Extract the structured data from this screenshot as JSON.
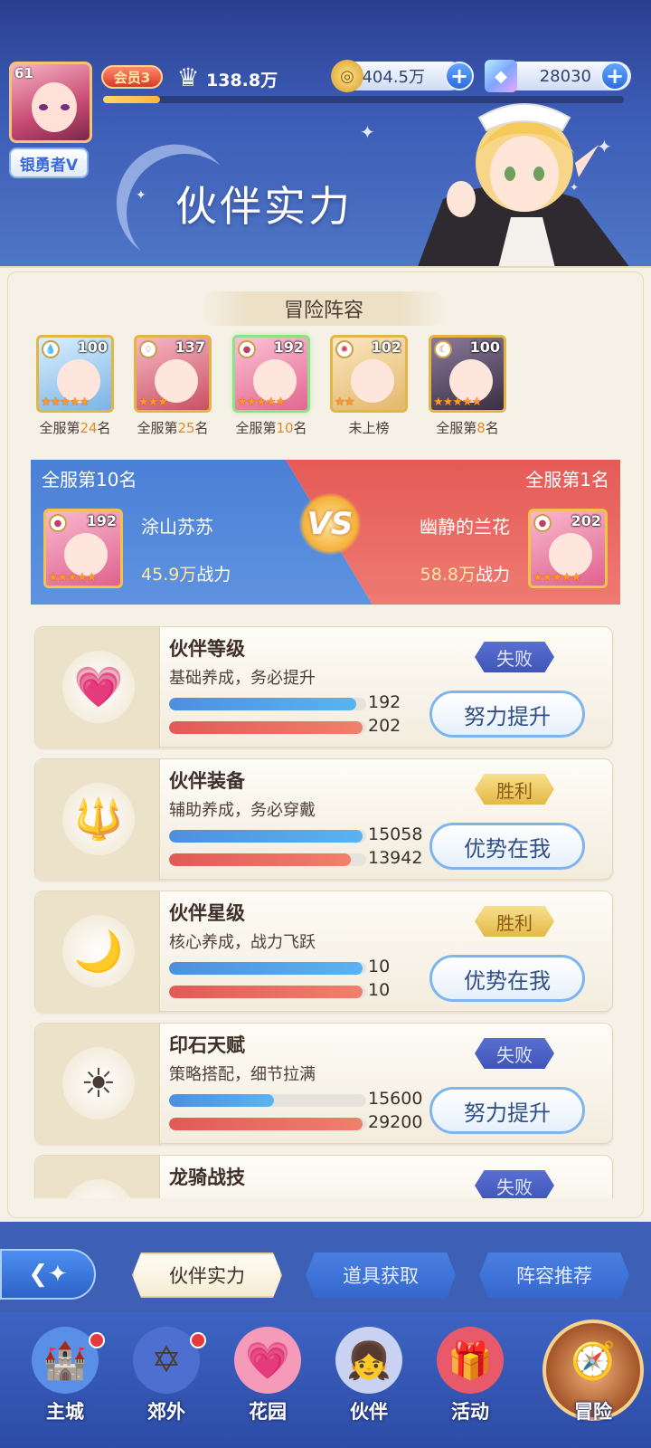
{
  "header": {
    "player_level": "61",
    "rank_title": "银勇者V",
    "vip_label": "会员3",
    "power": "138.8万",
    "exp_progress": 0.11,
    "gold": "404.5万",
    "diamonds": "28030",
    "title": "伙伴实力"
  },
  "section_title": "冒险阵容",
  "heroes": [
    {
      "level": "100",
      "rank_prefix": "全服第",
      "rank_num": "24",
      "rank_suffix": "名",
      "element": "water",
      "stars": 5,
      "colors": [
        "#d8f0ff",
        "#7cb3e6"
      ]
    },
    {
      "level": "137",
      "rank_prefix": "全服第",
      "rank_num": "25",
      "rank_suffix": "名",
      "element": "wind",
      "stars": 3,
      "colors": [
        "#f7b7c4",
        "#c95063"
      ]
    },
    {
      "level": "192",
      "rank_prefix": "全服第",
      "rank_num": "10",
      "rank_suffix": "名",
      "element": "fire",
      "stars": 5,
      "colors": [
        "#fbc2d4",
        "#e2668f"
      ]
    },
    {
      "level": "102",
      "rank_prefix": "",
      "rank_num": "",
      "rank_suffix": "未上榜",
      "element": "light",
      "stars": 2,
      "colors": [
        "#fbe7c0",
        "#e2b86c"
      ]
    },
    {
      "level": "100",
      "rank_prefix": "全服第",
      "rank_num": "8",
      "rank_suffix": "名",
      "element": "dark",
      "stars": 5,
      "colors": [
        "#8a7a9a",
        "#3a2f44"
      ]
    }
  ],
  "vs": {
    "left_rank": "全服第10名",
    "right_rank": "全服第1名",
    "left_level": "192",
    "right_level": "202",
    "left_name": "涂山苏苏",
    "right_name": "幽静的兰花",
    "left_power_value": "45.9万",
    "right_power_value": "58.8万",
    "power_unit": "战力",
    "logo": "VS"
  },
  "compare": [
    {
      "title": "伙伴等级",
      "desc": "基础养成，务必提升",
      "my": "192",
      "their": "202",
      "my_ratio": 0.95,
      "their_ratio": 0.98,
      "result": "失败",
      "result_type": "lose",
      "action": "努力提升",
      "icon": "exp-heart-icon",
      "glyph": "💗"
    },
    {
      "title": "伙伴装备",
      "desc": "辅助养成，务必穿戴",
      "my": "15058",
      "their": "13942",
      "my_ratio": 0.98,
      "their_ratio": 0.92,
      "result": "胜利",
      "result_type": "win",
      "action": "优势在我",
      "icon": "trident-icon",
      "glyph": "🔱"
    },
    {
      "title": "伙伴星级",
      "desc": "核心养成，战力飞跃",
      "my": "10",
      "their": "10",
      "my_ratio": 0.98,
      "their_ratio": 0.98,
      "result": "胜利",
      "result_type": "win",
      "action": "优势在我",
      "icon": "moon-star-icon",
      "glyph": "🌙"
    },
    {
      "title": "印石天赋",
      "desc": "策略搭配，细节拉满",
      "my": "15600",
      "their": "29200",
      "my_ratio": 0.53,
      "their_ratio": 0.98,
      "result": "失败",
      "result_type": "lose",
      "action": "努力提升",
      "icon": "sun-seal-icon",
      "glyph": "☀"
    },
    {
      "title": "龙骑战技",
      "desc": "",
      "my": "",
      "their": "",
      "my_ratio": 0,
      "their_ratio": 0,
      "result": "失败",
      "result_type": "lose",
      "action": "",
      "icon": "dragon-skill-icon",
      "glyph": "✦"
    }
  ],
  "tabs": [
    {
      "label": "伙伴实力",
      "active": true
    },
    {
      "label": "道具获取",
      "active": false
    },
    {
      "label": "阵容推荐",
      "active": false
    }
  ],
  "nav": [
    {
      "label": "主城",
      "icon": "castle-icon",
      "glyph": "🏰",
      "dot": true
    },
    {
      "label": "郊外",
      "icon": "portal-icon",
      "glyph": "✡",
      "dot": true
    },
    {
      "label": "花园",
      "icon": "heart-garden-icon",
      "glyph": "💗",
      "dot": false
    },
    {
      "label": "伙伴",
      "icon": "partner-icon",
      "glyph": "👧",
      "dot": false
    },
    {
      "label": "活动",
      "icon": "gift-icon",
      "glyph": "🎁",
      "dot": false
    },
    {
      "label": "冒险",
      "icon": "compass-icon",
      "glyph": "🧭",
      "dot": false
    }
  ]
}
